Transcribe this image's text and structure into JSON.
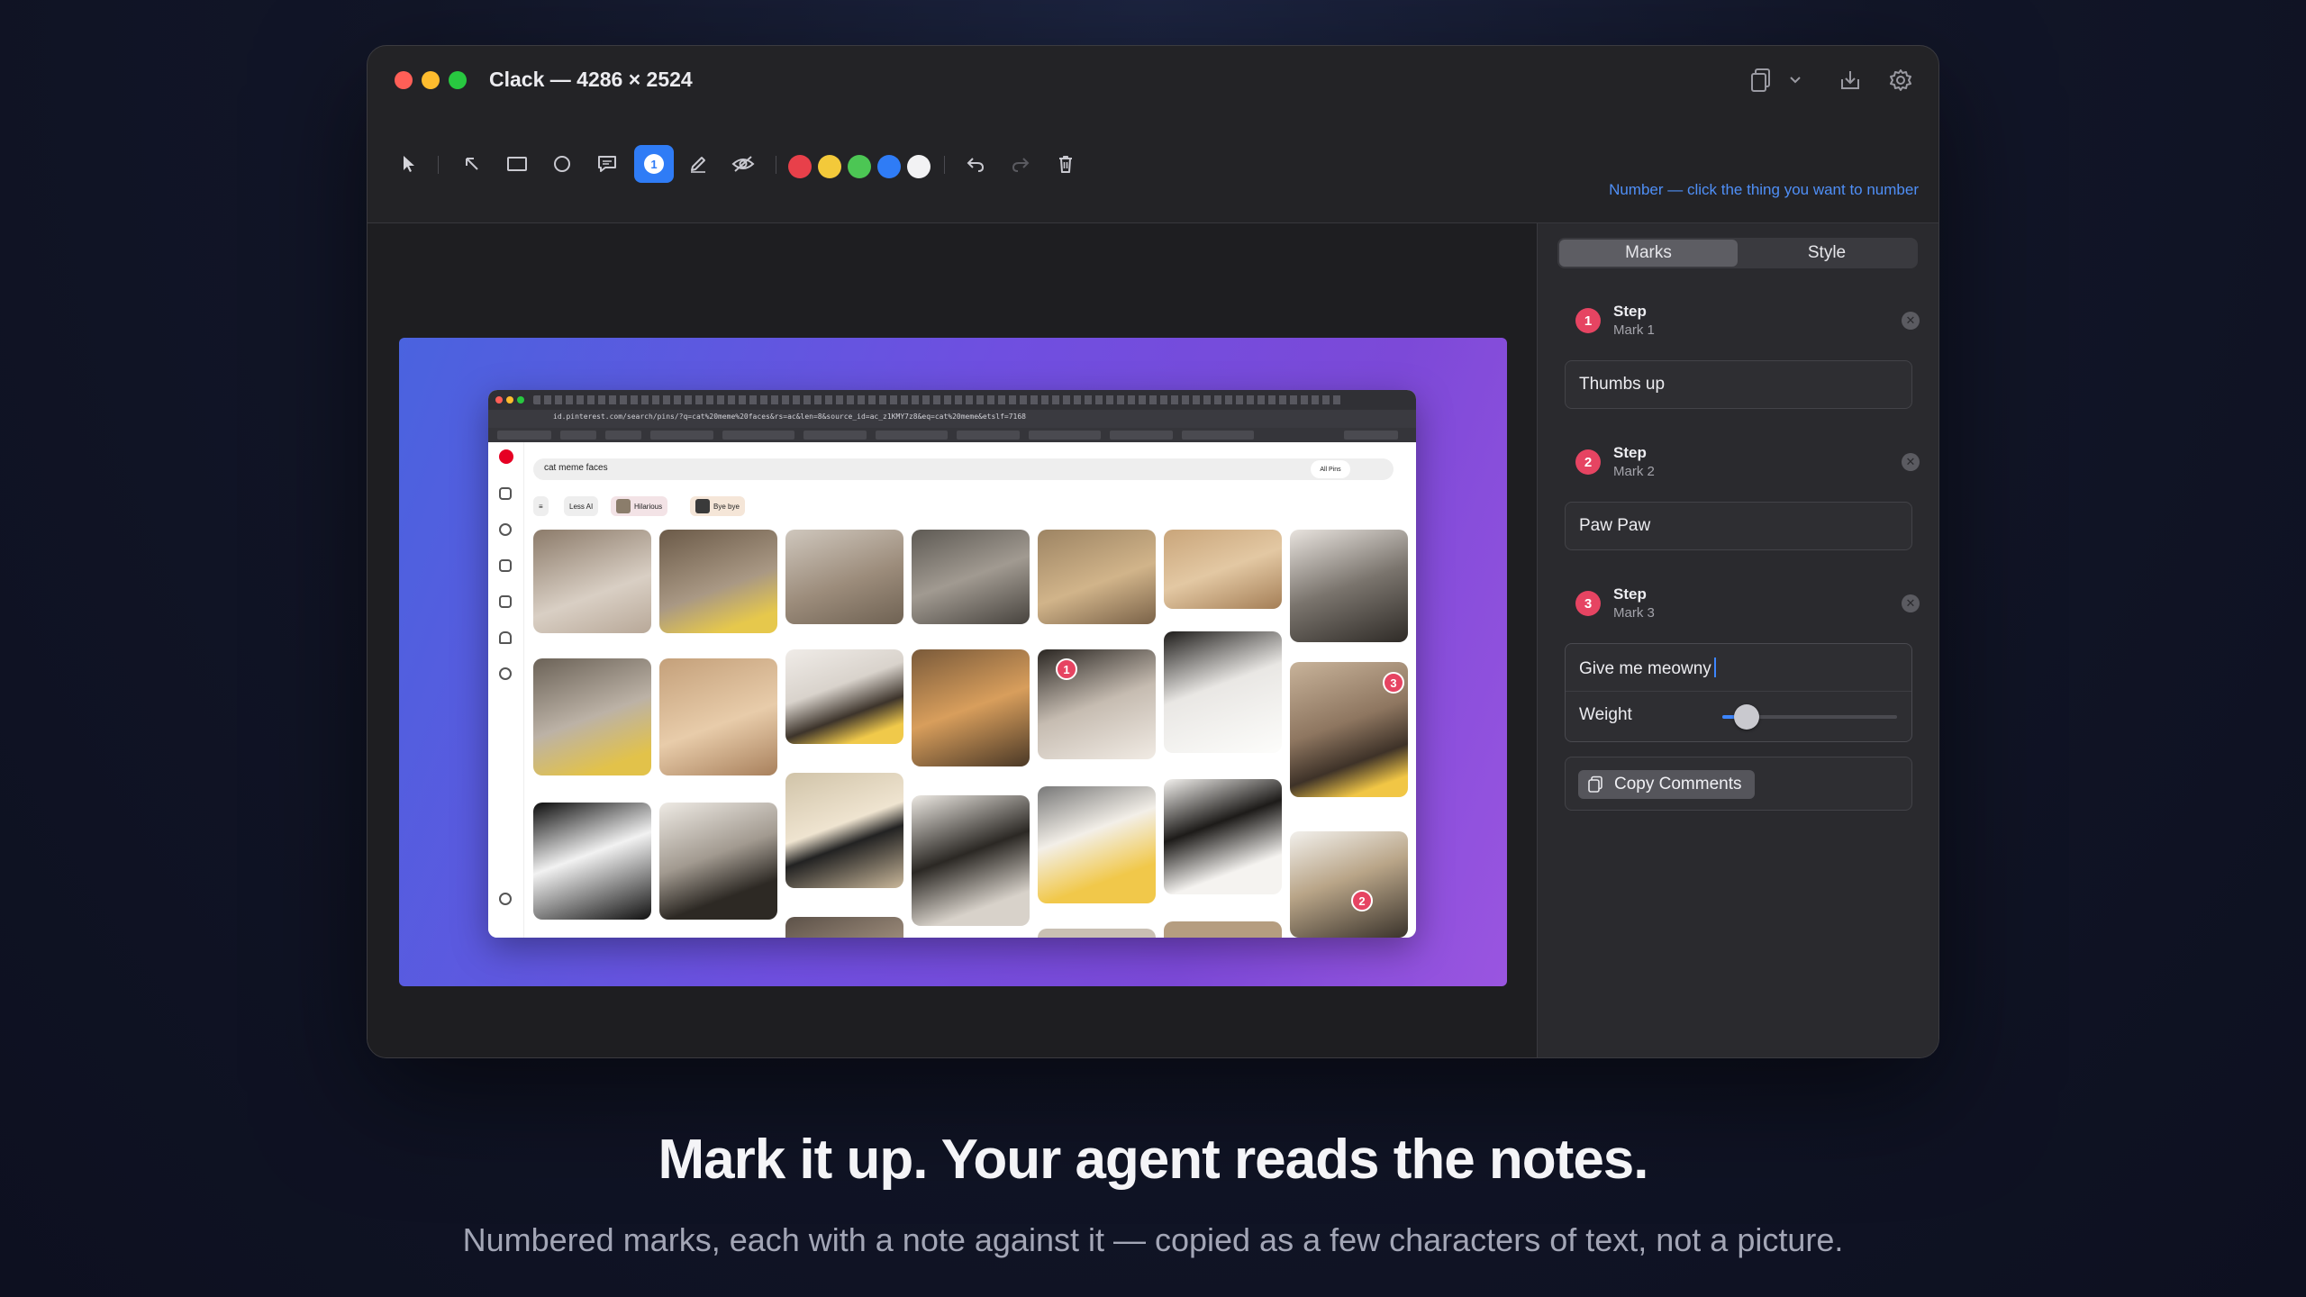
{
  "window": {
    "title": "Clack — 4286 × 2524",
    "hint": "Number — click the thing you want to number"
  },
  "toolbar": {
    "tools": [
      "select-icon",
      "arrow-icon",
      "rectangle-icon",
      "ellipse-icon",
      "callout-icon",
      "number-icon",
      "pen-icon",
      "blur-icon"
    ],
    "active_tool": "number-icon",
    "number_tool_glyph": "1",
    "colors": [
      "#e8404a",
      "#f3c93a",
      "#4cc654",
      "#2f7cf6",
      "#f2f2f4"
    ],
    "actions": [
      "undo-icon",
      "redo-icon",
      "trash-icon"
    ]
  },
  "panel": {
    "tabs": [
      "Marks",
      "Style"
    ],
    "active_tab": "Marks",
    "marks": [
      {
        "number": "1",
        "title": "Step",
        "sub": "Mark 1",
        "note": "Thumbs up"
      },
      {
        "number": "2",
        "title": "Step",
        "sub": "Mark 2",
        "note": "Paw Paw"
      },
      {
        "number": "3",
        "title": "Step",
        "sub": "Mark 3",
        "note": "Give me meowny"
      }
    ],
    "weight_label": "Weight",
    "weight_value": 0.14,
    "copy_label": "Copy Comments"
  },
  "screenshot": {
    "url": "id.pinterest.com/search/pins/?q=cat%20meme%20faces&rs=ac&len=8&source_id=ac_z1KMY7z8&eq=cat%20meme&etslf=7168",
    "search": "cat meme faces",
    "chips": [
      "Less AI",
      "Hilarious",
      "Bye bye"
    ],
    "filter_label": "All Pins",
    "badges": [
      "1",
      "2",
      "3"
    ]
  },
  "marketing": {
    "headline": "Mark it up. Your agent reads the notes.",
    "subline": "Numbered marks, each with a note against it — copied as a few characters of text, not a picture."
  },
  "colors": {
    "accent": "#2f7cf6",
    "mark_badge": "#e64462",
    "hint": "#4f8ff7"
  }
}
